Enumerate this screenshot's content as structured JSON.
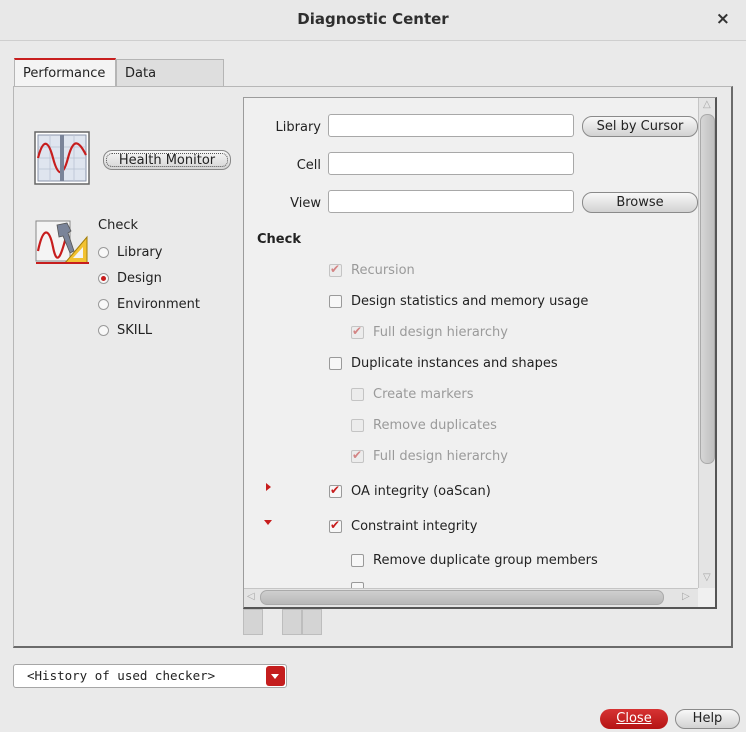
{
  "window": {
    "title": "Diagnostic Center",
    "close_glyph": "×"
  },
  "tabs": [
    {
      "label": "Performance",
      "active": true
    },
    {
      "label": "Data Integrity",
      "active": false
    }
  ],
  "left": {
    "health_monitor_label": "Health Monitor",
    "check_label": "Check",
    "radios": [
      {
        "label": "Library",
        "selected": false
      },
      {
        "label": "Design",
        "selected": true
      },
      {
        "label": "Environment",
        "selected": false
      },
      {
        "label": "SKILL",
        "selected": false
      }
    ]
  },
  "form": {
    "library_label": "Library",
    "library_value": "",
    "cell_label": "Cell",
    "cell_value": "",
    "view_label": "View",
    "view_value": "",
    "sel_by_cursor_label": "Sel by Cursor",
    "browse_label": "Browse"
  },
  "checks": {
    "section_title": "Check",
    "items": [
      {
        "label": "Recursion",
        "checked": true,
        "enabled": false
      },
      {
        "label": "Design statistics and memory usage",
        "checked": false,
        "enabled": true
      },
      {
        "label": "Full design hierarchy",
        "checked": true,
        "enabled": false
      },
      {
        "label": "Duplicate instances and shapes",
        "checked": false,
        "enabled": true
      },
      {
        "label": "Create markers",
        "checked": false,
        "enabled": false
      },
      {
        "label": "Remove duplicates",
        "checked": false,
        "enabled": false
      },
      {
        "label": "Full design hierarchy",
        "checked": true,
        "enabled": false
      },
      {
        "label": "OA integrity (oaScan)",
        "checked": true,
        "enabled": true
      },
      {
        "label": "Constraint integrity",
        "checked": true,
        "enabled": true
      },
      {
        "label": "Remove duplicate group members",
        "checked": false,
        "enabled": true
      }
    ]
  },
  "history": {
    "value": "<History of used checker>"
  },
  "footer": {
    "close_label": "Close",
    "help_label": "Help"
  },
  "colors": {
    "accent": "#c71d1d"
  }
}
